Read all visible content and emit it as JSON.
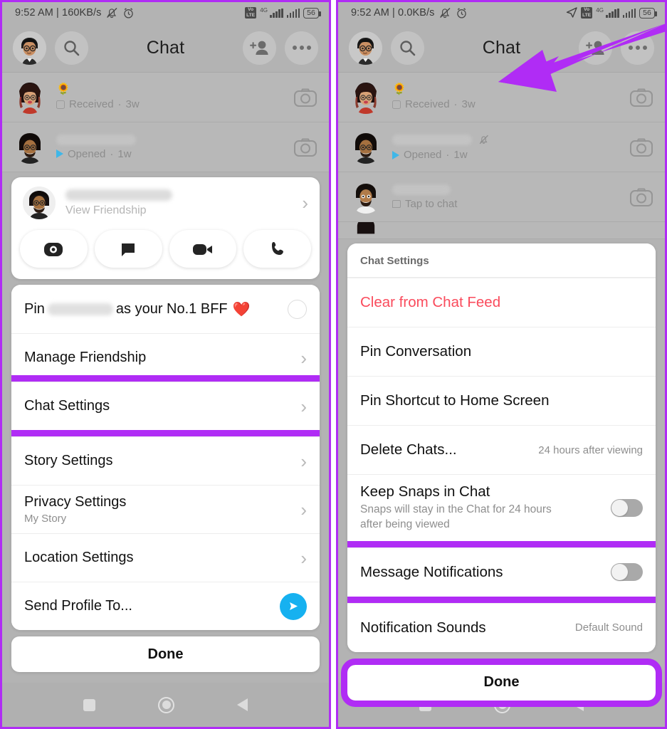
{
  "accent_color": "#b02cf5",
  "left_panel": {
    "status_bar": {
      "time_and_speed": "9:52 AM | 160KB/s",
      "network_type": "4G",
      "volte_label_top": "Vo",
      "volte_label_bottom": "LTE",
      "battery": "56"
    },
    "header": {
      "title": "Chat",
      "avatar_icon": "bitmoji-avatar",
      "search_icon": "search-icon",
      "add_friend_icon": "add-friend-icon",
      "more_icon": "more-options-icon"
    },
    "chat_rows": [
      {
        "name": "",
        "emoji": "🌻",
        "status": "Received",
        "time": "3w",
        "status_icon": "square-outline-icon",
        "camera_icon": "camera-icon"
      },
      {
        "name": "",
        "status": "Opened",
        "time": "1w",
        "status_icon": "sent-triangle-icon",
        "camera_icon": "camera-icon"
      }
    ],
    "friend_card": {
      "name": "",
      "subtitle": "View Friendship",
      "chevron": "›",
      "actions": [
        {
          "name": "camera-action",
          "icon": "camera-icon"
        },
        {
          "name": "chat-action",
          "icon": "chat-bubble-icon"
        },
        {
          "name": "video-call-action",
          "icon": "video-camera-icon"
        },
        {
          "name": "voice-call-action",
          "icon": "phone-icon"
        }
      ]
    },
    "settings": [
      {
        "label_prefix": "Pin",
        "label_suffix": "as your No.1 BFF",
        "emoji": "❤️",
        "control": "radio-circle",
        "name": "pin-bff-row",
        "highlighted": false
      },
      {
        "label": "Manage Friendship",
        "control": "chevron",
        "name": "manage-friendship-row",
        "highlighted": false
      },
      {
        "label": "Chat Settings",
        "control": "chevron",
        "name": "chat-settings-row",
        "highlighted": true
      },
      {
        "label": "Story Settings",
        "control": "chevron",
        "name": "story-settings-row",
        "highlighted": false
      },
      {
        "label": "Privacy Settings",
        "sub": "My Story",
        "control": "chevron",
        "name": "privacy-settings-row",
        "highlighted": false
      },
      {
        "label": "Location Settings",
        "control": "chevron",
        "name": "location-settings-row",
        "highlighted": false
      },
      {
        "label": "Send Profile To...",
        "control": "send-fab",
        "name": "send-profile-row",
        "highlighted": false
      }
    ],
    "done_label": "Done",
    "navbar": {
      "recents_icon": "square-recents-icon",
      "home_icon": "circle-home-icon",
      "back_icon": "triangle-back-icon"
    }
  },
  "right_panel": {
    "status_bar": {
      "time_and_speed": "9:52 AM | 0.0KB/s",
      "network_type": "4G",
      "volte_label_top": "Vo",
      "volte_label_bottom": "LTE",
      "battery": "56",
      "location_icon": "location-arrow-icon"
    },
    "header": {
      "title": "Chat",
      "avatar_icon": "bitmoji-avatar",
      "search_icon": "search-icon",
      "add_friend_icon": "add-friend-icon",
      "more_icon": "more-options-icon"
    },
    "chat_rows": [
      {
        "name": "",
        "emoji": "🌻",
        "status": "Received",
        "time": "3w",
        "status_icon": "square-outline-icon",
        "camera_icon": "camera-icon",
        "muted": false
      },
      {
        "name": "",
        "status": "Opened",
        "time": "1w",
        "status_icon": "sent-triangle-icon",
        "camera_icon": "camera-icon",
        "muted": true,
        "mute_icon": "bell-muted-icon"
      },
      {
        "name": "",
        "status": "Tap to chat",
        "time": "",
        "status_icon": "chat-bubble-outline-icon",
        "camera_icon": "camera-icon",
        "muted": false
      }
    ],
    "chat_settings_sheet": {
      "header": "Chat Settings",
      "rows": [
        {
          "label": "Clear from Chat Feed",
          "danger": true,
          "name": "clear-from-chat-feed-row",
          "highlighted": false
        },
        {
          "label": "Pin Conversation",
          "name": "pin-conversation-row",
          "highlighted": false
        },
        {
          "label": "Pin Shortcut to Home Screen",
          "name": "pin-shortcut-row",
          "highlighted": false
        },
        {
          "label": "Delete Chats...",
          "value": "24 hours after viewing",
          "name": "delete-chats-row",
          "highlighted": false
        },
        {
          "label": "Keep Snaps in Chat",
          "sub": "Snaps will stay in the Chat for 24 hours after being viewed",
          "toggle": "off",
          "name": "keep-snaps-row",
          "highlighted": false
        },
        {
          "label": "Message Notifications",
          "toggle": "off",
          "name": "message-notifications-row",
          "highlighted": true
        },
        {
          "label": "Notification Sounds",
          "value": "Default Sound",
          "name": "notification-sounds-row",
          "highlighted": false
        }
      ]
    },
    "done_label": "Done",
    "done_highlighted": true,
    "navbar": {
      "recents_icon": "square-recents-icon",
      "home_icon": "circle-home-icon",
      "back_icon": "triangle-back-icon"
    },
    "annotation": {
      "arrow_icon": "pointer-arrow-annotation",
      "points_to": "bell-muted-icon"
    }
  }
}
